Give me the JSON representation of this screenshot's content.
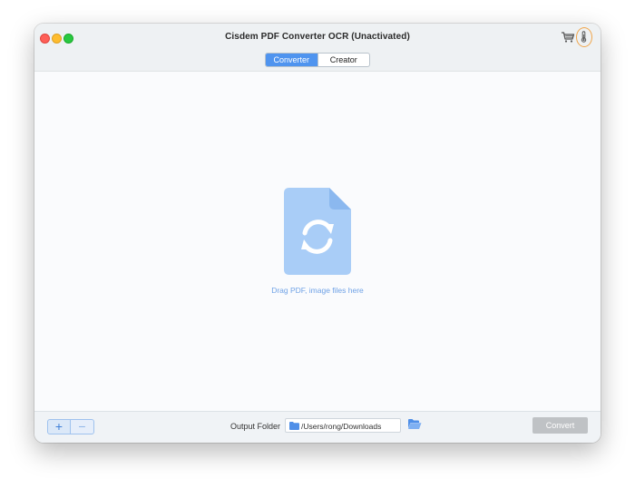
{
  "window": {
    "title": "Cisdem PDF Converter OCR (Unactivated)",
    "icons": {
      "cart": "cart-icon",
      "thermometer": "thermometer-icon"
    }
  },
  "tabs": [
    {
      "label": "Converter",
      "active": true
    },
    {
      "label": "Creator",
      "active": false
    }
  ],
  "dropzone": {
    "icon": "refresh-document-icon",
    "text": "Drag PDF, image files here"
  },
  "bottom": {
    "add_label": "+",
    "remove_label": "−",
    "output_label": "Output Folder",
    "output_path": "/Users/rong/Downloads",
    "browse_icon": "open-folder-icon",
    "convert_label": "Convert"
  },
  "colors": {
    "accent": "#4f94ef",
    "drop_icon": "#a9cdf7",
    "drop_text": "#6fa2e6",
    "convert_disabled": "#bfc2c5",
    "highlight": "#f0a54a"
  }
}
